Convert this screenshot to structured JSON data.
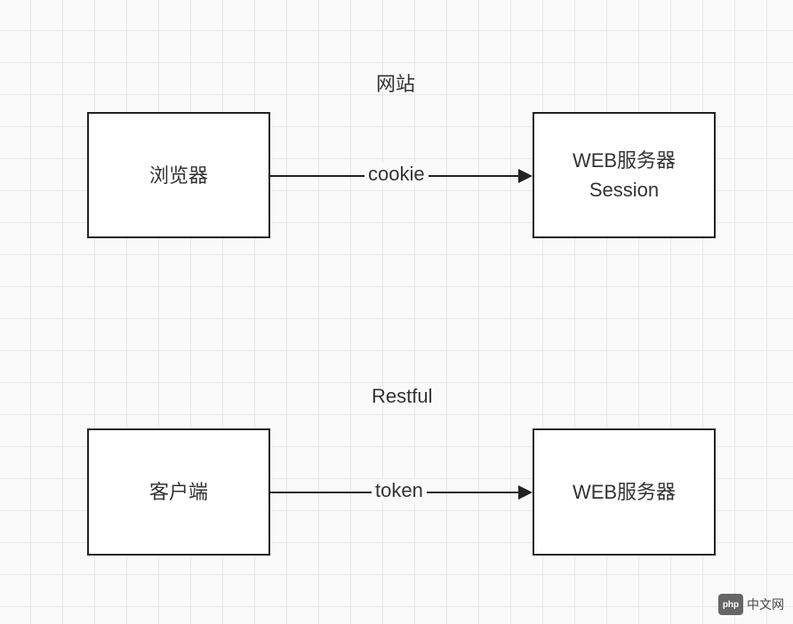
{
  "diagram1": {
    "title": "网站",
    "leftBox": "浏览器",
    "rightBoxLine1": "WEB服务器",
    "rightBoxLine2": "Session",
    "edgeLabel": "cookie"
  },
  "diagram2": {
    "title": "Restful",
    "leftBox": "客户端",
    "rightBox": "WEB服务器",
    "edgeLabel": "token"
  },
  "watermark": {
    "logo": "php",
    "text": "中文网"
  }
}
